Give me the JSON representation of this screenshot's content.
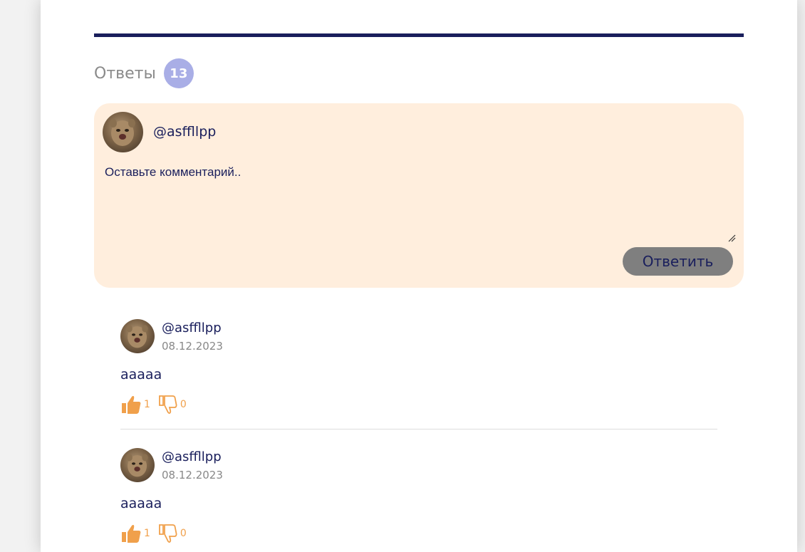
{
  "answers": {
    "title": "Ответы",
    "count": "13"
  },
  "composer": {
    "username": "@asffllpp",
    "placeholder": "Оставьте комментарий..",
    "reply_label": "Ответить"
  },
  "comments": [
    {
      "author": "@asffllpp",
      "date": "08.12.2023",
      "text": "aaaaa",
      "likes": "1",
      "dislikes": "0"
    },
    {
      "author": "@asffllpp",
      "date": "08.12.2023",
      "text": "aaaaa",
      "likes": "1",
      "dislikes": "0"
    }
  ],
  "colors": {
    "accent_navy": "#1a1f5c",
    "badge": "#a9aee6",
    "composer_bg": "#ffeedd",
    "reaction_orange": "#f0a04b",
    "button_gray": "#7f7f7f"
  },
  "icons": [
    "avatar-image",
    "thumbs-up-icon",
    "thumbs-down-icon",
    "resize-handle-icon"
  ]
}
